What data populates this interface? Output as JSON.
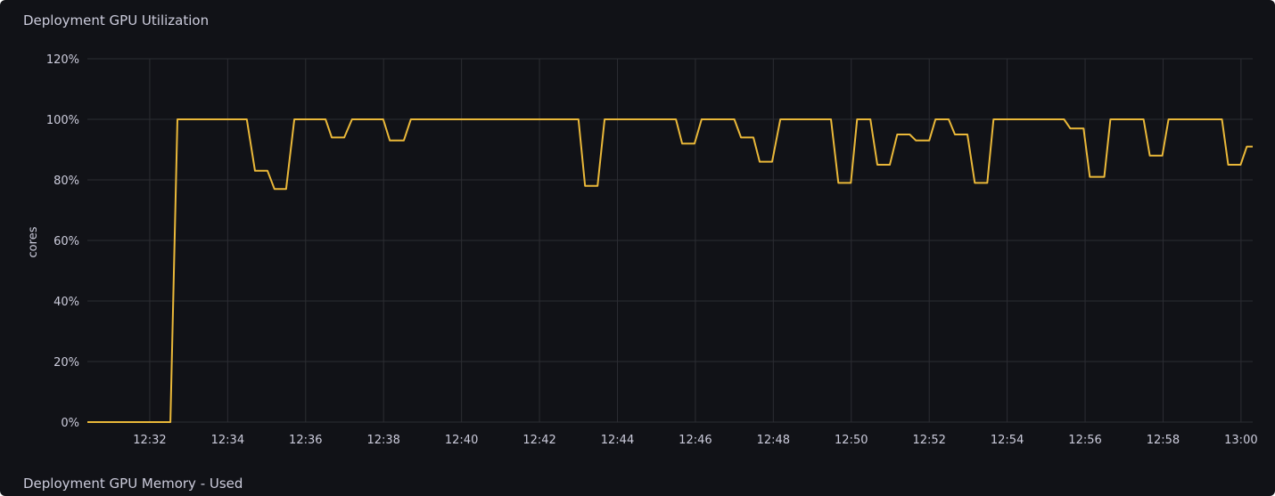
{
  "panels": [
    {
      "title": "Deployment GPU Utilization"
    },
    {
      "title": "Deployment GPU Memory - Used"
    }
  ],
  "chart_data": {
    "type": "line",
    "title": "Deployment GPU Utilization",
    "xlabel": "",
    "ylabel": "cores",
    "x_unit": "minutes after 12:00",
    "xlim": [
      30.4,
      60.3
    ],
    "ylim": [
      0,
      120
    ],
    "grid": true,
    "legend": "none",
    "y_ticks": [
      0,
      20,
      40,
      60,
      80,
      100,
      120
    ],
    "y_tick_labels": [
      "0%",
      "20%",
      "40%",
      "60%",
      "80%",
      "100%",
      "120%"
    ],
    "x_ticks": [
      32,
      34,
      36,
      38,
      40,
      42,
      44,
      46,
      48,
      50,
      52,
      54,
      56,
      58,
      60
    ],
    "x_tick_labels": [
      "12:32",
      "12:34",
      "12:36",
      "12:38",
      "12:40",
      "12:42",
      "12:44",
      "12:46",
      "12:48",
      "12:50",
      "12:52",
      "12:54",
      "12:56",
      "12:58",
      "13:00"
    ],
    "colors": {
      "line": "#eab839",
      "background": "#111217"
    },
    "series": [
      {
        "name": "GPU Utilization",
        "points": [
          [
            30.4,
            0
          ],
          [
            32.53,
            0
          ],
          [
            32.71,
            100
          ],
          [
            34.49,
            100
          ],
          [
            34.7,
            83
          ],
          [
            35.02,
            83
          ],
          [
            35.2,
            77
          ],
          [
            35.5,
            77
          ],
          [
            35.71,
            100
          ],
          [
            36.51,
            100
          ],
          [
            36.67,
            94
          ],
          [
            36.99,
            94
          ],
          [
            37.19,
            100
          ],
          [
            37.99,
            100
          ],
          [
            38.16,
            93
          ],
          [
            38.52,
            93
          ],
          [
            38.7,
            100
          ],
          [
            43.0,
            100
          ],
          [
            43.17,
            78
          ],
          [
            43.49,
            78
          ],
          [
            43.67,
            100
          ],
          [
            45.5,
            100
          ],
          [
            45.66,
            92
          ],
          [
            45.98,
            92
          ],
          [
            46.16,
            100
          ],
          [
            47.0,
            100
          ],
          [
            47.17,
            94
          ],
          [
            47.49,
            94
          ],
          [
            47.65,
            86
          ],
          [
            47.97,
            86
          ],
          [
            48.18,
            100
          ],
          [
            49.48,
            100
          ],
          [
            49.67,
            79
          ],
          [
            49.99,
            79
          ],
          [
            50.15,
            100
          ],
          [
            50.49,
            100
          ],
          [
            50.67,
            85
          ],
          [
            50.99,
            85
          ],
          [
            51.18,
            95
          ],
          [
            51.5,
            95
          ],
          [
            51.66,
            93
          ],
          [
            52.0,
            93
          ],
          [
            52.16,
            100
          ],
          [
            52.5,
            100
          ],
          [
            52.66,
            95
          ],
          [
            52.98,
            95
          ],
          [
            53.17,
            79
          ],
          [
            53.49,
            79
          ],
          [
            53.65,
            100
          ],
          [
            55.46,
            100
          ],
          [
            55.62,
            97
          ],
          [
            55.96,
            97
          ],
          [
            56.12,
            81
          ],
          [
            56.49,
            81
          ],
          [
            56.65,
            100
          ],
          [
            57.5,
            100
          ],
          [
            57.66,
            88
          ],
          [
            57.98,
            88
          ],
          [
            58.14,
            100
          ],
          [
            59.51,
            100
          ],
          [
            59.67,
            85
          ],
          [
            59.99,
            85
          ],
          [
            60.15,
            91
          ],
          [
            60.3,
            91
          ]
        ]
      }
    ]
  }
}
